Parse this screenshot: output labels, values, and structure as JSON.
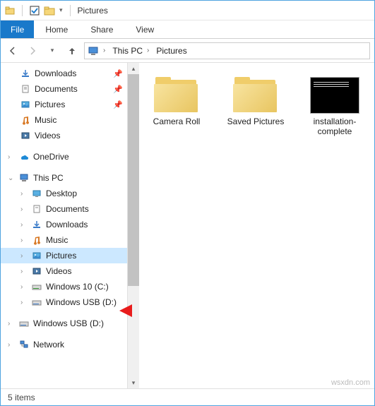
{
  "titlebar": {
    "title": "Pictures"
  },
  "ribbon": {
    "file": "File",
    "home": "Home",
    "share": "Share",
    "view": "View"
  },
  "breadcrumb": {
    "root": "This PC",
    "current": "Pictures"
  },
  "quickaccess": {
    "downloads": "Downloads",
    "documents": "Documents",
    "pictures": "Pictures",
    "music": "Music",
    "videos": "Videos"
  },
  "onedrive": "OneDrive",
  "thispc": {
    "label": "This PC",
    "desktop": "Desktop",
    "documents": "Documents",
    "downloads": "Downloads",
    "music": "Music",
    "pictures": "Pictures",
    "videos": "Videos",
    "drive_c": "Windows 10 (C:)",
    "drive_d": "Windows USB (D:)"
  },
  "usb": "Windows USB (D:)",
  "network": "Network",
  "items": {
    "cameraroll": "Camera Roll",
    "savedpictures": "Saved Pictures",
    "installation": "installation-complete"
  },
  "status": {
    "count": "5 items"
  },
  "watermark": "wsxdn.com"
}
